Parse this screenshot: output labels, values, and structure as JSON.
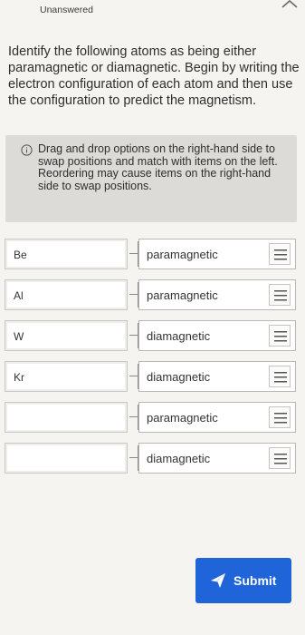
{
  "header": {
    "status": "Unanswered",
    "collapse_icon": "chevron-up-icon"
  },
  "question": {
    "text": "Identify the following atoms as being either paramagnetic or diamagnetic. Begin by writing the electron configuration of each atom and then use the configuration to predict the magnetism."
  },
  "info": {
    "icon": "info-icon",
    "line1": "Drag and drop options on the right-hand side to swap positions and match with items on the left.",
    "line2": "Reordering may cause items on the right-hand side to swap positions."
  },
  "rows": [
    {
      "left": "Be",
      "right": "paramagnetic"
    },
    {
      "left": "Al",
      "right": "paramagnetic"
    },
    {
      "left": "W",
      "right": "diamagnetic"
    },
    {
      "left": "Kr",
      "right": "diamagnetic"
    },
    {
      "left": "",
      "right": "paramagnetic"
    },
    {
      "left": "",
      "right": "diamagnetic"
    }
  ],
  "drag_handle_icon": "grip-lines-icon",
  "submit": {
    "label": "Submit",
    "icon": "send-icon",
    "color": "#1f64d8"
  }
}
